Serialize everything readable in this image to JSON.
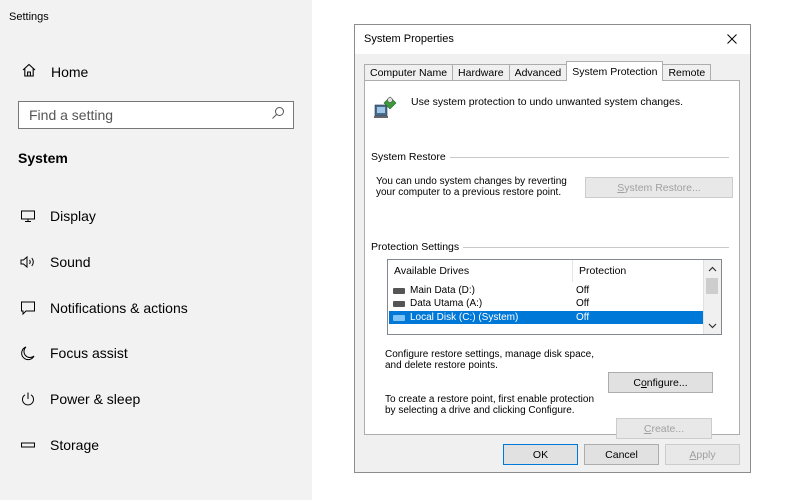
{
  "settings": {
    "title": "Settings",
    "home_label": "Home",
    "search_placeholder": "Find a setting",
    "section_title": "System",
    "nav": [
      {
        "label": "Display",
        "icon": "monitor-icon"
      },
      {
        "label": "Sound",
        "icon": "speaker-icon"
      },
      {
        "label": "Notifications & actions",
        "icon": "notification-icon"
      },
      {
        "label": "Focus assist",
        "icon": "moon-icon"
      },
      {
        "label": "Power & sleep",
        "icon": "power-icon"
      },
      {
        "label": "Storage",
        "icon": "storage-icon"
      }
    ]
  },
  "dialog": {
    "title": "System Properties",
    "tabs": [
      "Computer Name",
      "Hardware",
      "Advanced",
      "System Protection",
      "Remote"
    ],
    "active_tab": "System Protection",
    "intro": "Use system protection to undo unwanted system changes.",
    "restore_group": "System Restore",
    "restore_text_1": "You can undo system changes by reverting",
    "restore_text_2": "your computer to a previous restore point.",
    "restore_button": {
      "underline": "S",
      "rest": "ystem Restore..."
    },
    "protection_group": "Protection Settings",
    "columns": [
      "Available Drives",
      "Protection"
    ],
    "drives": [
      {
        "name": "Main Data (D:)",
        "protection": "Off",
        "selected": false
      },
      {
        "name": "Data Utama (A:)",
        "protection": "Off",
        "selected": false
      },
      {
        "name": "Local Disk (C:) (System)",
        "protection": "Off",
        "selected": true
      }
    ],
    "configure_text_1": "Configure restore settings, manage disk space,",
    "configure_text_2": "and delete restore points.",
    "configure_button": {
      "pre": "C",
      "underline": "o",
      "rest": "nfigure..."
    },
    "create_text_1": "To create a restore point, first enable protection",
    "create_text_2": "by selecting a drive and clicking Configure.",
    "create_button": {
      "underline": "C",
      "rest": "reate..."
    },
    "ok_label": "OK",
    "cancel_label": "Cancel",
    "apply_button": {
      "underline": "A",
      "rest": "pply"
    }
  }
}
